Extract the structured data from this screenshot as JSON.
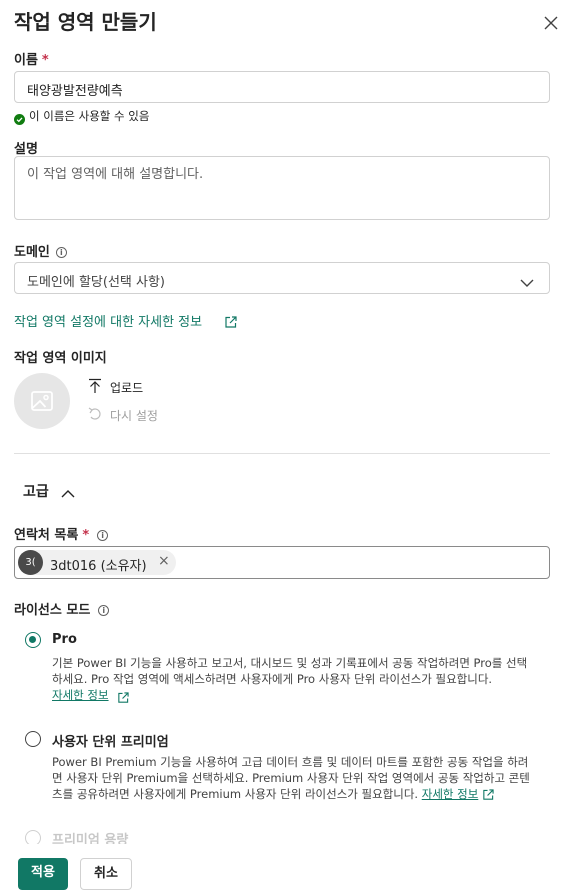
{
  "dialog": {
    "title": "작업 영역 만들기"
  },
  "name_field": {
    "label": "이름",
    "required_mark": "*",
    "value": "태양광발전량예측",
    "validation": "이 이름은 사용할 수 있음"
  },
  "description_field": {
    "label": "설명",
    "placeholder": "이 작업 영역에 대해 설명합니다."
  },
  "domain_field": {
    "label": "도메인",
    "info": "i",
    "placeholder": "도메인에 할당(선택 사항)"
  },
  "settings_link": "작업 영역 설정에 대한 자세한 정보",
  "image_section": {
    "label": "작업 영역 이미지",
    "upload": "업로드",
    "reset": "다시 설정"
  },
  "advanced": {
    "label": "고급"
  },
  "contacts": {
    "label": "연락처 목록",
    "required_mark": "*",
    "info": "i",
    "chip": {
      "initials": "3(",
      "name": "3dt016 (소유자)",
      "remove": "×"
    }
  },
  "license": {
    "label": "라이선스 모드",
    "info": "i",
    "options": [
      {
        "title": "Pro",
        "desc": "기본 Power BI 기능을 사용하고 보고서, 대시보드 및 성과 기록표에서 공동 작업하려면 Pro를 선택하세요. Pro 작업 영역에 액세스하려면 사용자에게 Pro 사용자 단위 라이선스가 필요합니다.",
        "link": "자세한 정보"
      },
      {
        "title": "사용자 단위 프리미엄",
        "desc": "Power BI Premium 기능을 사용하여 고급 데이터 흐름 및 데이터 마트를 포함한 공동 작업을 하려면 사용자 단위 Premium을 선택하세요. Premium 사용자 단위 작업 영역에서 공동 작업하고 콘텐츠를 공유하려면 사용자에게 Premium 사용자 단위 라이선스가 필요합니다.",
        "link": "자세한 정보"
      },
      {
        "title": "프리미엄 용량"
      }
    ],
    "selected": "Pro"
  },
  "footer": {
    "apply": "적용",
    "cancel": "취소"
  },
  "colors": {
    "accent": "#117865",
    "required": "#c4314b",
    "success": "#107c10"
  }
}
